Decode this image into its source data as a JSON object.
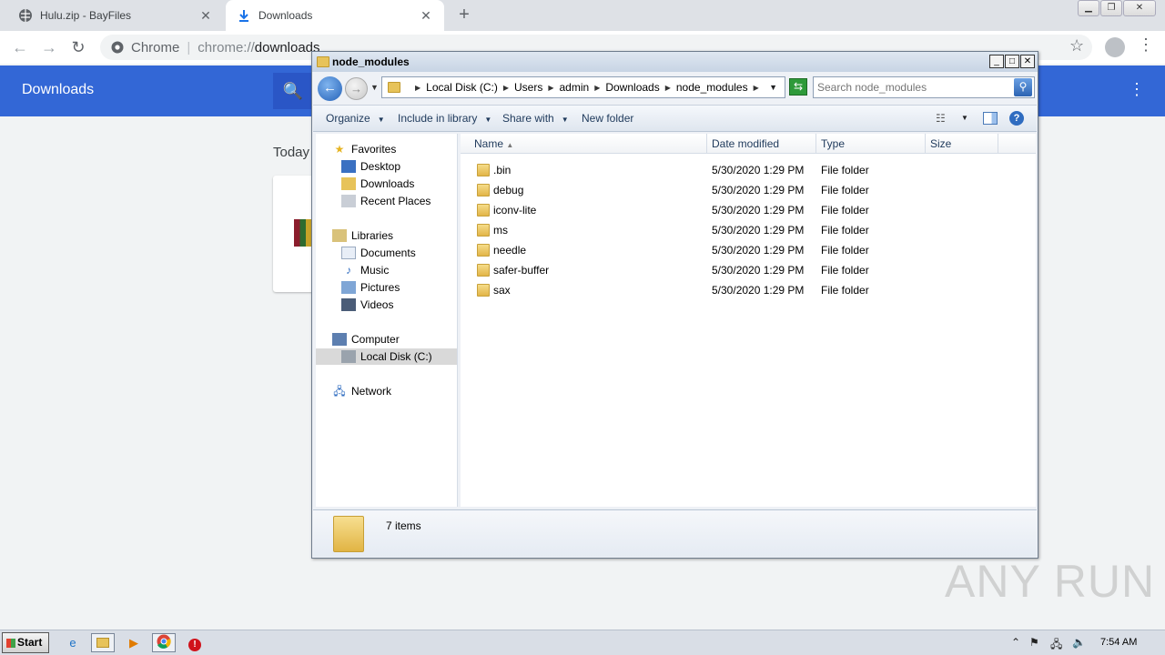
{
  "browser": {
    "tabs": [
      {
        "title": "Hulu.zip - BayFiles",
        "icon": "globe-icon"
      },
      {
        "title": "Downloads",
        "icon": "download-icon"
      }
    ],
    "omnibox": {
      "site_name": "Chrome",
      "url_scheme": "chrome://",
      "url_host": "downloads"
    }
  },
  "downloads_page": {
    "header_title": "Downloads",
    "section_label": "Today"
  },
  "explorer": {
    "title": "node_modules",
    "breadcrumbs": [
      "Local Disk (C:)",
      "Users",
      "admin",
      "Downloads",
      "node_modules"
    ],
    "search_placeholder": "Search node_modules",
    "commands": {
      "organize": "Organize",
      "include": "Include in library",
      "share": "Share with",
      "new_folder": "New folder"
    },
    "columns": [
      "Name",
      "Date modified",
      "Type",
      "Size"
    ],
    "nav": {
      "favorites": "Favorites",
      "desktop": "Desktop",
      "downloads": "Downloads",
      "recent": "Recent Places",
      "libraries": "Libraries",
      "documents": "Documents",
      "music": "Music",
      "pictures": "Pictures",
      "videos": "Videos",
      "computer": "Computer",
      "local_disk": "Local Disk (C:)",
      "network": "Network"
    },
    "files": [
      {
        "name": ".bin",
        "date": "5/30/2020 1:29 PM",
        "type": "File folder"
      },
      {
        "name": "debug",
        "date": "5/30/2020 1:29 PM",
        "type": "File folder"
      },
      {
        "name": "iconv-lite",
        "date": "5/30/2020 1:29 PM",
        "type": "File folder"
      },
      {
        "name": "ms",
        "date": "5/30/2020 1:29 PM",
        "type": "File folder"
      },
      {
        "name": "needle",
        "date": "5/30/2020 1:29 PM",
        "type": "File folder"
      },
      {
        "name": "safer-buffer",
        "date": "5/30/2020 1:29 PM",
        "type": "File folder"
      },
      {
        "name": "sax",
        "date": "5/30/2020 1:29 PM",
        "type": "File folder"
      }
    ],
    "item_count": "7 items"
  },
  "taskbar": {
    "start_label": "Start",
    "clock": "7:54 AM"
  },
  "watermark": "ANY RUN"
}
